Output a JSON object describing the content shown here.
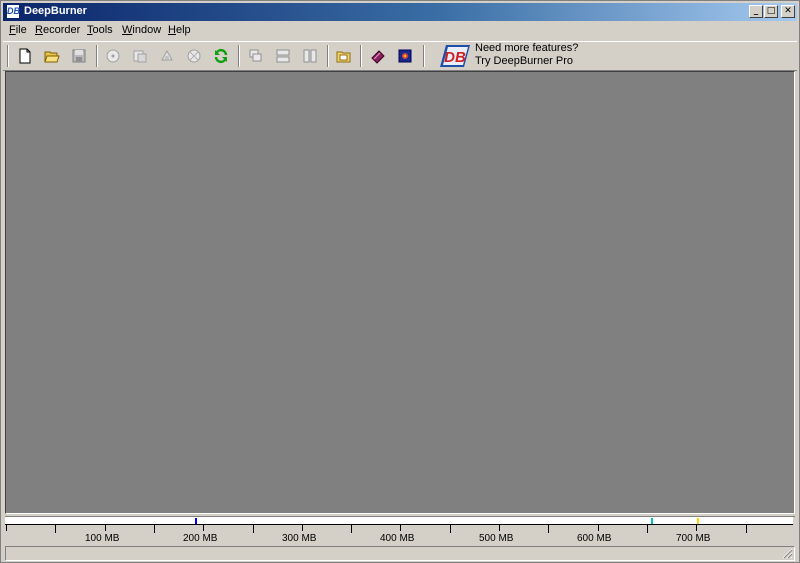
{
  "window": {
    "title": "DeepBurner",
    "app_icon_text": "DB",
    "controls": {
      "minimize": "_",
      "maximize": "□",
      "close": "✕"
    }
  },
  "menu": [
    {
      "accel": "F",
      "rest": "ile"
    },
    {
      "accel": "R",
      "rest": "ecorder"
    },
    {
      "accel": "T",
      "rest": "ools"
    },
    {
      "accel": "W",
      "rest": "indow"
    },
    {
      "accel": "H",
      "rest": "elp"
    }
  ],
  "toolbar": {
    "icons": [
      "new-file-icon",
      "open-folder-icon",
      "save-icon",
      "burn-disc-icon",
      "copy-disc-icon",
      "erase-disc-icon",
      "disc-info-icon",
      "refresh-icon",
      "cascade-windows-icon",
      "tile-horizontal-icon",
      "tile-vertical-icon",
      "explore-icon",
      "help-book-icon",
      "about-icon"
    ],
    "promo_line1": "Need more features?",
    "promo_line2": "Try DeepBurner Pro",
    "logo_text": "DB"
  },
  "capacity_ruler": {
    "labels": [
      "100 MB",
      "200 MB",
      "300 MB",
      "400 MB",
      "500 MB",
      "600 MB",
      "700 MB"
    ],
    "marker_colors": {
      "cd_74": "#0000ff",
      "cd_80": "#00c0c0",
      "cd_90": "#ffd700"
    }
  }
}
